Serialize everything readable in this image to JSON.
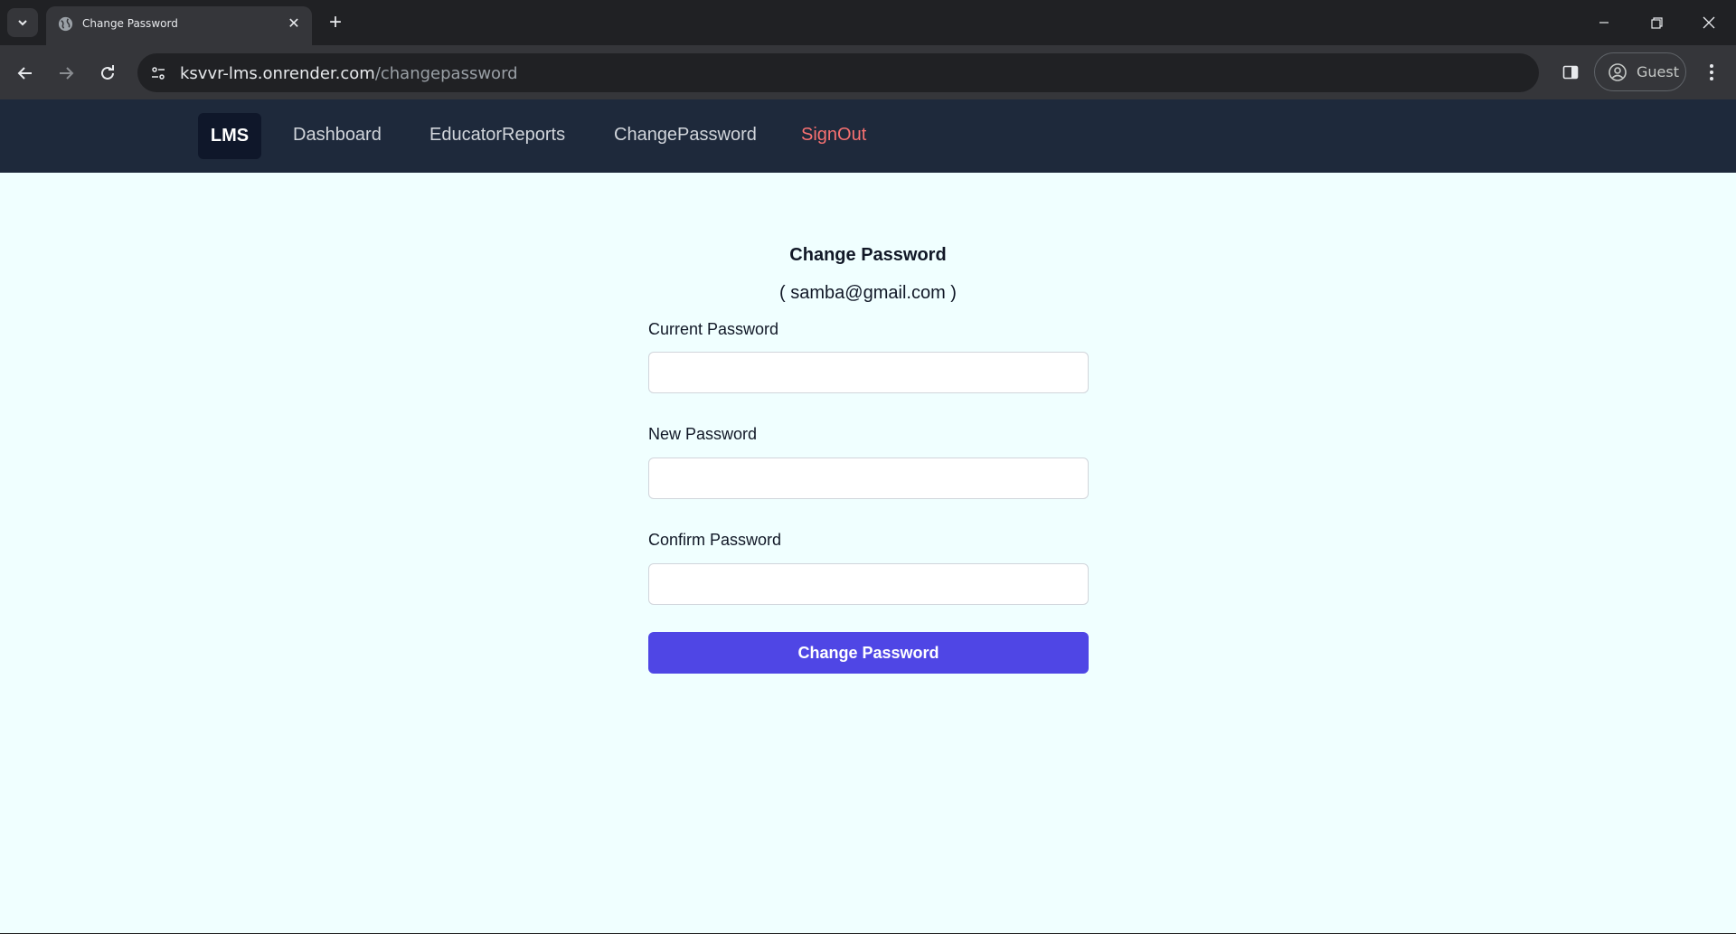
{
  "browser": {
    "tab_title": "Change Password",
    "url_host": "ksvvr-lms.onrender.com",
    "url_path": "/changepassword",
    "profile_label": "Guest"
  },
  "nav": {
    "brand": "LMS",
    "links": [
      "Dashboard",
      "EducatorReports",
      "ChangePassword",
      "SignOut"
    ]
  },
  "form": {
    "title": "Change Password",
    "email": "( samba@gmail.com )",
    "fields": [
      {
        "label": "Current Password",
        "value": ""
      },
      {
        "label": "New Password",
        "value": ""
      },
      {
        "label": "Confirm Password",
        "value": ""
      }
    ],
    "submit_label": "Change Password"
  },
  "colors": {
    "nav_bg": "#1e293b",
    "brand_bg": "#0f172a",
    "signout": "#f87171",
    "page_bg": "#f0ffff",
    "button_bg": "#4f46e5"
  }
}
